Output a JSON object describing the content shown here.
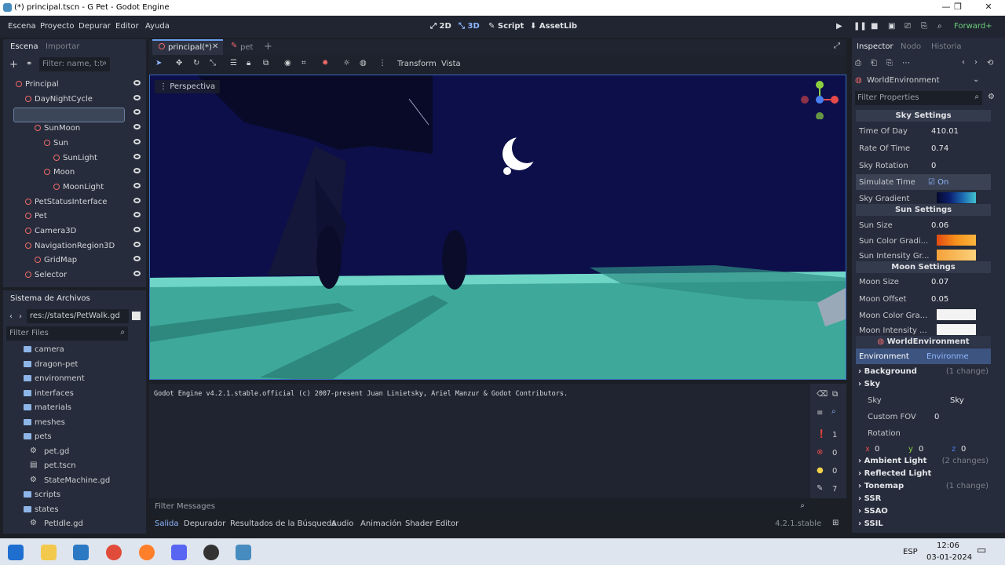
{
  "window": {
    "title": "(*) principal.tscn - G Pet - Godot Engine",
    "min": "—",
    "max": "❐",
    "close": "✕"
  },
  "menu": [
    "Escena",
    "Proyecto",
    "Depurar",
    "Editor",
    "Ayuda"
  ],
  "modes": {
    "m2d": "2D",
    "m3d": "3D",
    "script": "Script",
    "assetlib": "AssetLib"
  },
  "renderer": "Forward+",
  "scene_dock": {
    "tab1": "Escena",
    "tab2": "Importar",
    "filter": "Filter: name, t:t",
    "nodes": [
      {
        "label": "Principal",
        "indent": 0
      },
      {
        "label": "DayNightCycle",
        "indent": 1
      },
      {
        "label": "WorldEnvironment",
        "indent": 2
      },
      {
        "label": "SunMoon",
        "indent": 2
      },
      {
        "label": "Sun",
        "indent": 3
      },
      {
        "label": "SunLight",
        "indent": 4
      },
      {
        "label": "Moon",
        "indent": 3
      },
      {
        "label": "MoonLight",
        "indent": 4
      },
      {
        "label": "PetStatusInterface",
        "indent": 1
      },
      {
        "label": "Pet",
        "indent": 1
      },
      {
        "label": "Camera3D",
        "indent": 1
      },
      {
        "label": "NavigationRegion3D",
        "indent": 1
      },
      {
        "label": "GridMap",
        "indent": 2
      },
      {
        "label": "Selector",
        "indent": 1
      }
    ]
  },
  "fs_dock": {
    "title": "Sistema de Archivos",
    "path": "res://states/PetWalk.gd",
    "filter": "Filter Files",
    "items": [
      {
        "label": "camera",
        "type": "folder",
        "indent": 1
      },
      {
        "label": "dragon-pet",
        "type": "folder",
        "indent": 1
      },
      {
        "label": "environment",
        "type": "folder",
        "indent": 1
      },
      {
        "label": "interfaces",
        "type": "folder",
        "indent": 1
      },
      {
        "label": "materials",
        "type": "folder",
        "indent": 1
      },
      {
        "label": "meshes",
        "type": "folder",
        "indent": 1
      },
      {
        "label": "pets",
        "type": "folder",
        "indent": 1
      },
      {
        "label": "pet.gd",
        "type": "gear",
        "indent": 2
      },
      {
        "label": "pet.tscn",
        "type": "scene",
        "indent": 2
      },
      {
        "label": "StateMachine.gd",
        "type": "gear",
        "indent": 2
      },
      {
        "label": "scripts",
        "type": "folder",
        "indent": 1
      },
      {
        "label": "states",
        "type": "folder",
        "indent": 1
      },
      {
        "label": "PetIdle.gd",
        "type": "gear",
        "indent": 2
      }
    ]
  },
  "editor_tabs": [
    "principal(*)",
    "pet"
  ],
  "viewport": {
    "transform": "Transform",
    "vista": "Vista",
    "perspective": "Perspectiva"
  },
  "console": {
    "line": "Godot Engine v4.2.1.stable.official (c) 2007-present Juan Linietsky, Ariel Manzur & Godot Contributors.",
    "filter": "Filter Messages",
    "counts": {
      "messages": "1",
      "errors": "0",
      "warnings": "0",
      "info": "7"
    }
  },
  "bottom_tabs": [
    "Salida",
    "Depurador",
    "Resultados de la Búsqueda",
    "Audio",
    "Animación",
    "Shader Editor"
  ],
  "version": "4.2.1.stable",
  "inspector": {
    "tabs": [
      "Inspector",
      "Nodo",
      "Historia"
    ],
    "node": "WorldEnvironment",
    "filter": "Filter Properties",
    "sky_settings": "Sky Settings",
    "sun_settings": "Sun Settings",
    "moon_settings": "Moon Settings",
    "world_env": "WorldEnvironment",
    "time_of_day": {
      "k": "Time Of Day",
      "v": "410.01"
    },
    "rate_of_time": {
      "k": "Rate Of Time",
      "v": "0.74"
    },
    "sky_rotation": {
      "k": "Sky Rotation",
      "v": "0"
    },
    "simulate_time": {
      "k": "Simulate Time",
      "v": "On"
    },
    "sky_gradient": {
      "k": "Sky Gradient"
    },
    "sun_size": {
      "k": "Sun Size",
      "v": "0.06"
    },
    "sun_color": {
      "k": "Sun Color Gradi..."
    },
    "sun_intensity": {
      "k": "Sun Intensity Gr..."
    },
    "moon_size": {
      "k": "Moon Size",
      "v": "0.07"
    },
    "moon_offset": {
      "k": "Moon Offset",
      "v": "0.05"
    },
    "moon_color": {
      "k": "Moon Color Gra..."
    },
    "moon_intensity": {
      "k": "Moon Intensity ..."
    },
    "environment": {
      "k": "Environment",
      "v": "Environme"
    },
    "groups": [
      {
        "label": "Background",
        "note": "(1 change)"
      },
      {
        "label": "Sky",
        "note": ""
      }
    ],
    "sky": {
      "k": "Sky",
      "v": "Sky"
    },
    "custom_fov": {
      "k": "Custom FOV",
      "v": "0"
    },
    "rotation": {
      "k": "Rotation",
      "x": "0",
      "y": "0",
      "z": "0",
      "xl": "x",
      "yl": "y",
      "zl": "z"
    },
    "groups2": [
      {
        "label": "Ambient Light",
        "note": "(2 changes)"
      },
      {
        "label": "Reflected Light",
        "note": ""
      },
      {
        "label": "Tonemap",
        "note": "(1 change)"
      },
      {
        "label": "SSR",
        "note": ""
      },
      {
        "label": "SSAO",
        "note": ""
      },
      {
        "label": "SSIL",
        "note": ""
      }
    ]
  },
  "taskbar": {
    "lang": "ESP",
    "time": "12:06",
    "date": "03-01-2024"
  },
  "colors": {
    "accent": "#478cbf",
    "sky": "#0d0f4a",
    "ground": "#3ea99a"
  }
}
